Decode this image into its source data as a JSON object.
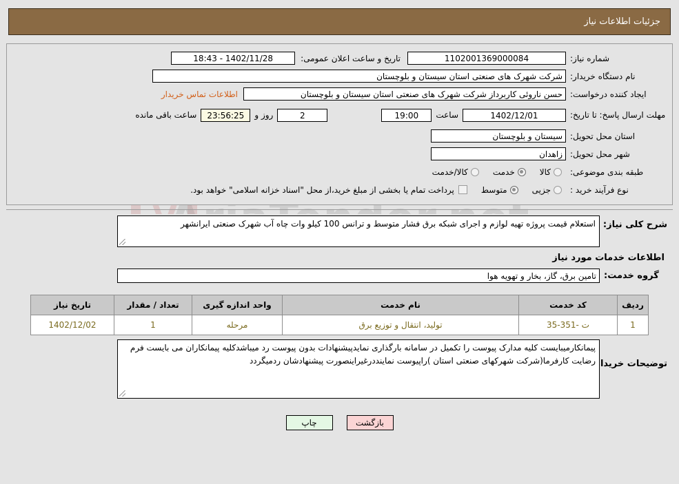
{
  "header": {
    "title": "جزئیات اطلاعات نیاز"
  },
  "watermark": {
    "text": "AriaTender.net",
    "mark": "V"
  },
  "form": {
    "need_number": {
      "label": "شماره نیاز:",
      "value": "1102001369000084"
    },
    "public_announce": {
      "label": "تاریخ و ساعت اعلان عمومی:",
      "value": "1402/11/28 - 18:43"
    },
    "buyer_org": {
      "label": "نام دستگاه خریدار:",
      "value": "شرکت شهرک های صنعتی استان سیستان و بلوچستان"
    },
    "requester": {
      "label": "ایجاد کننده درخواست:",
      "value": "حسن ناروئی کاربرداز شرکت شهرک های صنعتی استان سیستان و بلوچستان",
      "contact_link": "اطلاعات تماس خریدار"
    },
    "deadline": {
      "label": "مهلت ارسال پاسخ: تا تاریخ:",
      "date": "1402/12/01",
      "time_label": "ساعت",
      "time": "19:00",
      "days": "2",
      "days_label": "روز و",
      "countdown": "23:56:25",
      "countdown_label": "ساعت باقی مانده"
    },
    "delivery_province": {
      "label": "استان محل تحویل:",
      "value": "سیستان و بلوچستان"
    },
    "delivery_city": {
      "label": "شهر محل تحویل:",
      "value": "زاهدان"
    },
    "category": {
      "label": "طبقه بندی موضوعی:",
      "options": [
        {
          "label": "کالا",
          "selected": false
        },
        {
          "label": "خدمت",
          "selected": true
        },
        {
          "label": "کالا/خدمت",
          "selected": false
        }
      ]
    },
    "purchase_type": {
      "label": "نوع فرآیند خرید :",
      "options": [
        {
          "label": "جزیی",
          "selected": false
        },
        {
          "label": "متوسط",
          "selected": true
        }
      ],
      "checkbox_label": "پرداخت تمام یا بخشی از مبلغ خرید،از محل \"اسناد خزانه اسلامی\" خواهد بود.",
      "checkbox_checked": false
    }
  },
  "description": {
    "label": "شرح کلی نیاز:",
    "value": "استعلام قیمت پروژه تهیه لوازم و اجرای شبکه برق فشار متوسط  و ترانس 100 کیلو وات چاه آب شهرک صنعتی  ایرانشهر"
  },
  "services_section": {
    "title": "اطلاعات خدمات مورد نیاز",
    "group_label": "گروه خدمت:",
    "group_value": "تامین برق، گاز، بخار و تهویه هوا"
  },
  "table": {
    "headers": [
      "ردیف",
      "کد خدمت",
      "نام خدمت",
      "واحد اندازه گیری",
      "تعداد / مقدار",
      "تاریخ نیاز"
    ],
    "rows": [
      {
        "row_no": "1",
        "service_code": "ت -351-35",
        "service_name": "تولید، انتقال و توزیع برق",
        "unit": "مرحله",
        "quantity": "1",
        "need_date": "1402/12/02"
      }
    ]
  },
  "buyer_notes": {
    "label": "توضیحات خریدار:",
    "value": "پیمانکارمیبایست کلیه مدارک پیوست را تکمیل در سامانه بارگذاری نمایدپیشنهادات بدون پیوست رد میباشدکلیه پیمانکاران می بایست فرم رضایت کارفرما(شرکت شهرکهای صنعتی استان )راپیوست نماینددرغیراینصورت پیشنهادشان ردمیگردد"
  },
  "buttons": {
    "print": "چاپ",
    "back": "بازگشت"
  }
}
